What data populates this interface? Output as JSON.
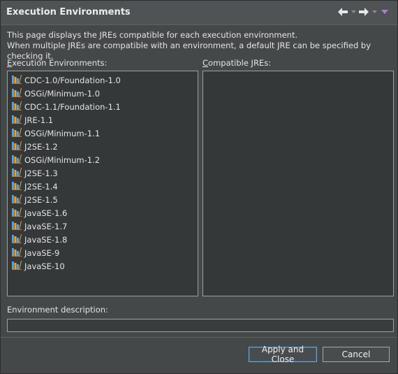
{
  "header": {
    "title": "Execution Environments"
  },
  "intro": {
    "line1": "This page displays the JREs compatible for each execution environment.",
    "line2": "When multiple JREs are compatible with an environment, a default JRE can be specified by checking it."
  },
  "labels": {
    "env_mnemonic": "E",
    "env_rest": "xecution Environments:",
    "jre_mnemonic": "C",
    "jre_rest": "ompatible JREs:",
    "description": "Environment description:"
  },
  "environments": [
    "CDC-1.0/Foundation-1.0",
    "OSGi/Minimum-1.0",
    "CDC-1.1/Foundation-1.1",
    "JRE-1.1",
    "OSGi/Minimum-1.1",
    "J2SE-1.2",
    "OSGi/Minimum-1.2",
    "J2SE-1.3",
    "J2SE-1.4",
    "J2SE-1.5",
    "JavaSE-1.6",
    "JavaSE-1.7",
    "JavaSE-1.8",
    "JavaSE-9",
    "JavaSE-10"
  ],
  "buttons": {
    "apply_close": "Apply and Close",
    "cancel": "Cancel"
  },
  "icons": {
    "back": "back-arrow-icon",
    "forward": "forward-arrow-icon",
    "menu": "view-menu-icon",
    "environment": "execution-environment-icon"
  },
  "colors": {
    "background": "#454849",
    "list_background": "#353839",
    "focus_border": "#6fa8dc"
  }
}
